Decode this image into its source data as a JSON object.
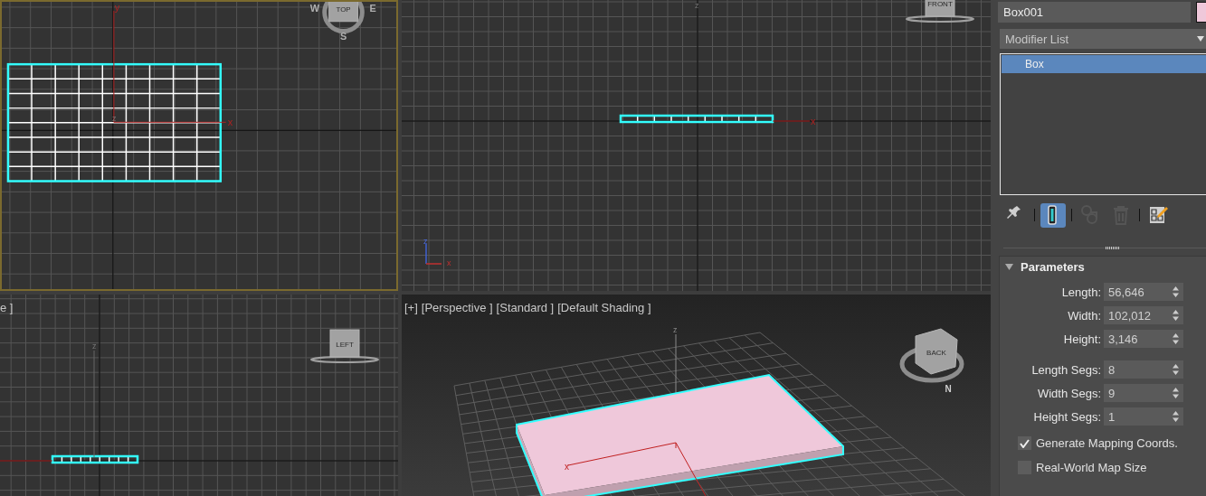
{
  "viewports": [
    {
      "kind": "top",
      "active": true,
      "axes": [
        "y",
        "z",
        "x"
      ],
      "view_cube": {
        "face": "TOP",
        "compass": [
          "W",
          "E",
          "S"
        ]
      }
    },
    {
      "kind": "front",
      "active": false,
      "axes": [
        "z",
        "x"
      ],
      "trihedron": [
        "z",
        "x"
      ],
      "view_cube": {
        "face": "FRONT"
      }
    },
    {
      "kind": "left",
      "active": false,
      "menus": [
        "e ]"
      ],
      "axes": [
        "z"
      ],
      "view_cube": {
        "face": "LEFT"
      }
    },
    {
      "kind": "perspective",
      "active": false,
      "menus": [
        "[+]",
        "[Perspective ]",
        "[Standard ]",
        "[Default Shading ]"
      ],
      "axes": [
        "z",
        "x"
      ],
      "view_cube": {
        "face": "BACK",
        "compass": [
          "N"
        ]
      }
    }
  ],
  "object": {
    "name": "Box001",
    "color": "#efc8da"
  },
  "modifier_list": {
    "label": "Modifier List"
  },
  "modifier_stack": [
    {
      "label": "Box",
      "selected": true
    }
  ],
  "stack_toolbar": [
    {
      "kind": "pin",
      "active": false
    },
    {
      "kind": "end_result",
      "active": true
    },
    {
      "kind": "make_unique",
      "active": false
    },
    {
      "kind": "remove",
      "active": false
    },
    {
      "kind": "configure",
      "active": false
    }
  ],
  "rollout": {
    "title": "Parameters",
    "expanded": true,
    "spinner_groups": [
      [
        {
          "label": "Length:",
          "value": "56,646"
        },
        {
          "label": "Width:",
          "value": "102,012"
        },
        {
          "label": "Height:",
          "value": "3,146"
        }
      ],
      [
        {
          "label": "Length Segs:",
          "value": "8"
        },
        {
          "label": "Width Segs:",
          "value": "9"
        },
        {
          "label": "Height Segs:",
          "value": "1"
        }
      ]
    ],
    "checkboxes": [
      {
        "label": "Generate Mapping Coords.",
        "checked": true
      },
      {
        "label": "Real-World Map Size",
        "checked": false
      }
    ]
  }
}
